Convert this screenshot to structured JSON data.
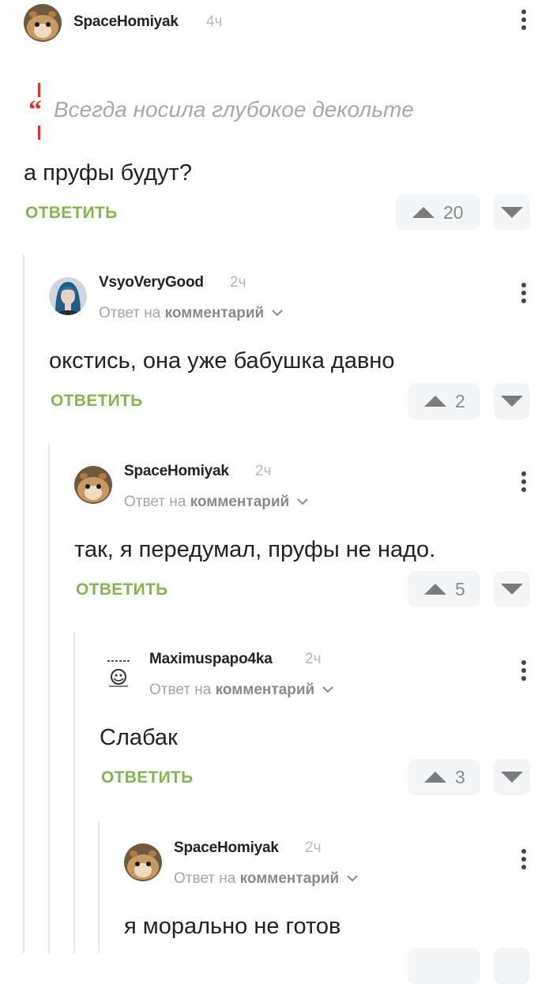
{
  "reply_label": "ОТВЕТИТЬ",
  "reply_to_prefix": "Ответ на",
  "reply_to_link": "комментарий",
  "colors": {
    "accent_green": "#7fb94b",
    "quote_red": "#e0342b",
    "vote_bg": "#f4f5f7"
  },
  "comments": [
    {
      "user": "SpaceHomiyak",
      "time": "4ч",
      "quote": "Всегда носила глубокое декольте",
      "text": "а пруфы будут?",
      "votes": "20"
    },
    {
      "user": "VsyoVeryGood",
      "time": "2ч",
      "text": "окстись, она уже бабушка давно",
      "votes": "2"
    },
    {
      "user": "SpaceHomiyak",
      "time": "2ч",
      "text": "так, я передумал, пруфы не надо.",
      "votes": "5"
    },
    {
      "user": "Maximuspapo4ka",
      "time": "2ч",
      "text": "Слабак",
      "votes": "3"
    },
    {
      "user": "SpaceHomiyak",
      "time": "2ч",
      "text": "я морально не готов"
    }
  ]
}
